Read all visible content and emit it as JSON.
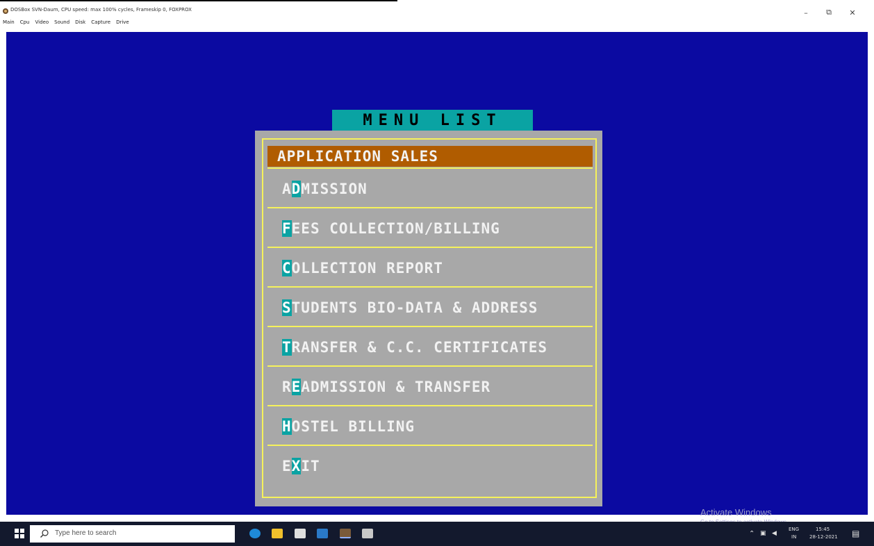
{
  "window": {
    "title": "DOSBox SVN-Daum, CPU speed: max 100% cycles, Frameskip 0, FOXPROX",
    "menu": [
      "Main",
      "Cpu",
      "Video",
      "Sound",
      "Disk",
      "Capture",
      "Drive"
    ],
    "controls": {
      "minimize": "–",
      "maximize": "⧉",
      "close": "✕"
    }
  },
  "dos_menu": {
    "title": "MENU LIST",
    "items": [
      {
        "label": "APPLICATION SALES",
        "hotkey_index": -1,
        "selected": true
      },
      {
        "label": "ADMISSION",
        "hotkey_index": 1,
        "selected": false
      },
      {
        "label": "FEES COLLECTION/BILLING",
        "hotkey_index": 0,
        "selected": false
      },
      {
        "label": "COLLECTION REPORT",
        "hotkey_index": 0,
        "selected": false
      },
      {
        "label": "STUDENTS BIO-DATA & ADDRESS",
        "hotkey_index": 0,
        "selected": false
      },
      {
        "label": "TRANSFER & C.C. CERTIFICATES",
        "hotkey_index": 0,
        "selected": false
      },
      {
        "label": "READMISSION & TRANSFER",
        "hotkey_index": 1,
        "selected": false
      },
      {
        "label": "HOSTEL BILLING",
        "hotkey_index": 0,
        "selected": false
      },
      {
        "label": "EXIT",
        "hotkey_index": 1,
        "selected": false
      }
    ],
    "colors": {
      "screen_bg": "#0b0aa1",
      "panel_bg": "#a8a8a8",
      "frame": "#f6f25a",
      "selection": "#b05c00",
      "hotkey_bg": "#0aa3a3"
    }
  },
  "watermark": {
    "line1": "Activate Windows",
    "line2": "Go to Settings to activate Windows."
  },
  "taskbar": {
    "search_placeholder": "Type here to search",
    "apps": [
      "edge-icon",
      "file-explorer-icon",
      "store-icon",
      "mail-icon",
      "dosbox-icon",
      "app-window-icon"
    ],
    "tray": {
      "lang": "ENG",
      "region": "IN",
      "time": "15:45",
      "date": "28-12-2021"
    }
  }
}
